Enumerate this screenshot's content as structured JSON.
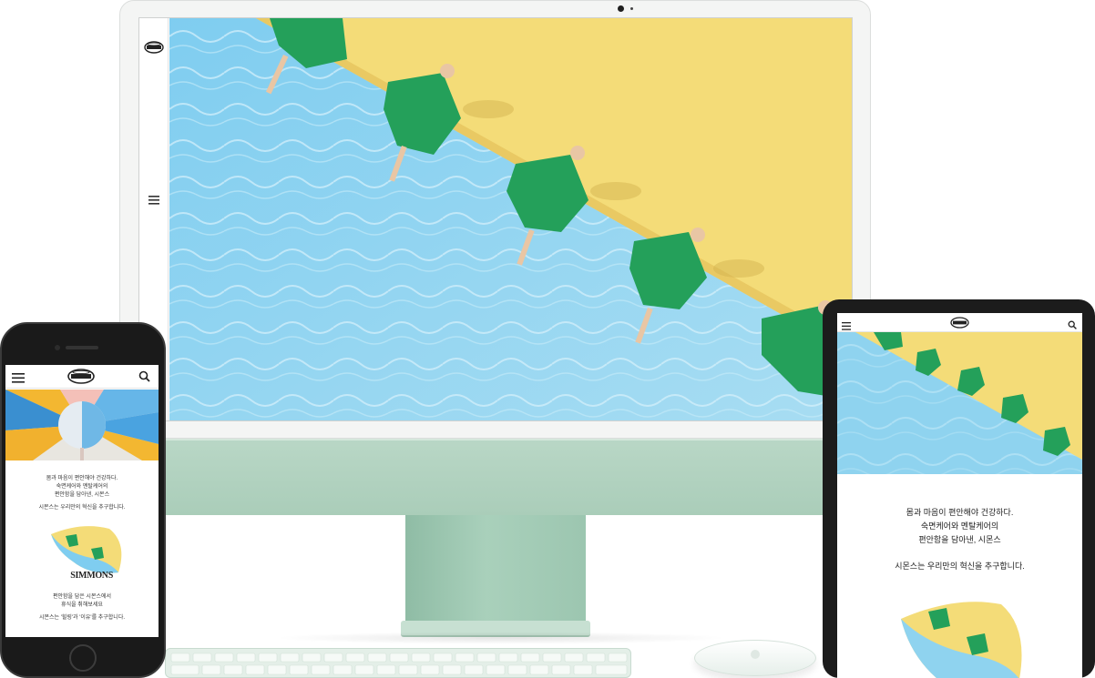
{
  "desktop": {
    "sidebar": {
      "logo": "simmons-logo-icon",
      "menu": "hamburger-menu-icon"
    },
    "hero": {
      "image": "pool-dresses-photo"
    }
  },
  "mobile": {
    "header": {
      "menu": "hamburger-menu-icon",
      "logo": "simmons-logo-icon",
      "search": "search-icon"
    },
    "intro_lines": [
      "몸과 마음이 편안해야 건강하다.",
      "숙면케어와 멘탈케어의",
      "편안함을 담아낸, 시몬스"
    ],
    "intro_sub": "시몬스는 우리만의 혁신을 추구합니다.",
    "brand_label": "SIMMONS",
    "outro_lines": [
      "편안함을 담은 시몬스에서",
      "휴식을 취해보세요"
    ],
    "outro_sub": "시몬스는 '힐링'과 '이유'를 추구합니다."
  },
  "tablet": {
    "header": {
      "menu": "hamburger-menu-icon",
      "logo": "simmons-logo-icon",
      "search": "search-icon"
    },
    "intro_lines": [
      "몸과 마음이 편안해야 건강하다.",
      "숙면케어와 멘탈케어의",
      "편안함을 담아낸, 시몬스"
    ],
    "intro_sub": "시몬스는 우리만의 혁신을 추구합니다."
  },
  "colors": {
    "pool": "#8fd3ef",
    "sand": "#f6e07a",
    "dress": "#2ea35c",
    "imac_green": "#aacdb9"
  }
}
